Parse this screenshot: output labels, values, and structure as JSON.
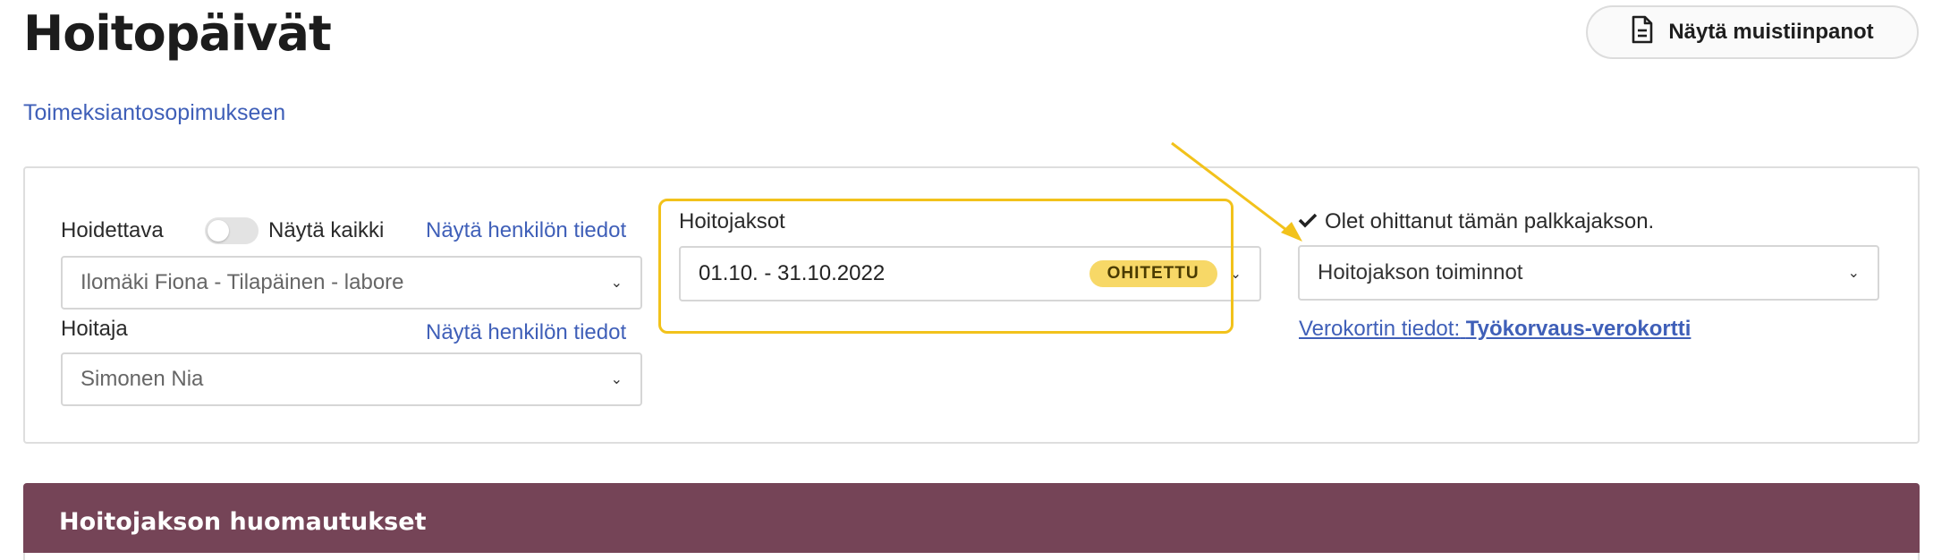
{
  "page": {
    "title": "Hoitopäivät",
    "notes_button_label": "Näytä muistiinpanot",
    "agreement_link": "Toimeksiantosopimukseen"
  },
  "filters": {
    "patient_label": "Hoidettava",
    "show_all_label": "Näytä kaikki",
    "show_person_info": "Näytä henkilön tiedot",
    "patient_value": "Ilomäki Fiona - Tilapäinen - labore",
    "caregiver_label": "Hoitaja",
    "caregiver_value": "Simonen Nia"
  },
  "periods": {
    "label": "Hoitojaksot",
    "value": "01.10. - 31.10.2022",
    "badge": "OHITETTU"
  },
  "actions": {
    "skipped_message": "Olet ohittanut tämän palkkajakson.",
    "actions_value": "Hoitojakson toiminnot",
    "tax_card_prefix": "Verokortin tiedot:",
    "tax_card_link": "Työkorvaus-verokortti"
  },
  "banner": {
    "title": "Hoitojakson huomautukset"
  },
  "colors": {
    "accent_yellow": "#f2c21b",
    "banner": "#754457",
    "link": "#3f5fb8"
  },
  "icons": {
    "notes": "document-icon",
    "check": "check-icon",
    "chevron": "chevron-down-icon"
  }
}
